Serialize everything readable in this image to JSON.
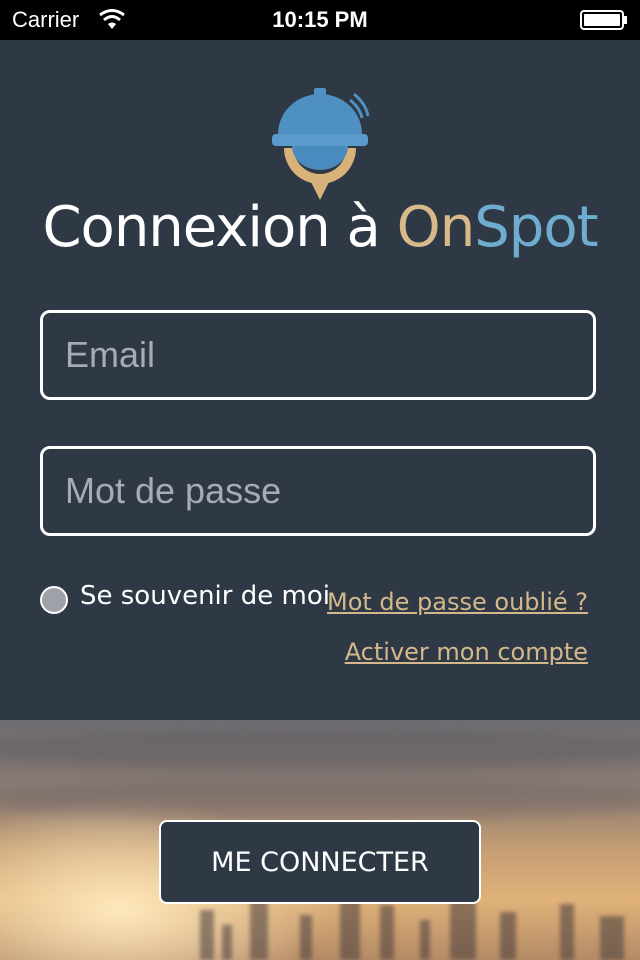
{
  "status_bar": {
    "carrier": "Carrier",
    "time": "10:15 PM",
    "icons": [
      "wifi-icon",
      "battery-icon"
    ]
  },
  "logo": {
    "icon": "service-bell-location-pin-icon",
    "colors": [
      "#4a8bbf",
      "#d9b27a"
    ]
  },
  "title": {
    "prefix": "Connexion à ",
    "brand_part1": "On",
    "brand_part2": "Spot"
  },
  "form": {
    "email_placeholder": "Email",
    "email_value": "",
    "password_placeholder": "Mot de passe",
    "password_value": "",
    "remember_label": "Se souvenir de moi",
    "remember_checked": false,
    "forgot_link": "Mot de passe oublié ?",
    "activate_link": "Activer mon compte"
  },
  "connect_button": "ME CONNECTER",
  "colors": {
    "background": "#2f3946",
    "accent_gold": "#d8b98a",
    "accent_blue": "#6eacd0",
    "link": "#d3b88c"
  }
}
